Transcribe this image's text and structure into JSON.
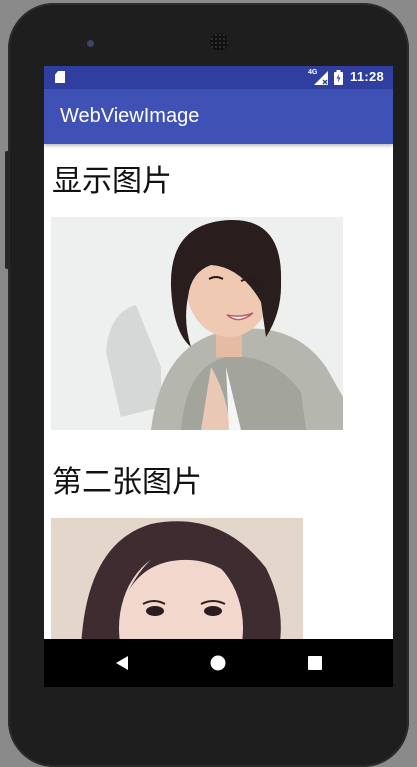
{
  "status_bar": {
    "time": "11:28",
    "network": "4G",
    "icons": [
      "sd-card-icon",
      "signal-icon",
      "battery-icon"
    ]
  },
  "app_bar": {
    "title": "WebViewImage"
  },
  "content": {
    "heading_1": "显示图片",
    "heading_2": "第二张图片",
    "images": [
      "photo-woman-short-hair",
      "photo-woman-long-hair"
    ]
  },
  "nav_bar": {
    "icons": [
      "back-icon",
      "home-icon",
      "recents-icon"
    ]
  },
  "colors": {
    "status_bar": "#303f9f",
    "app_bar": "#3f51b5",
    "page_background": "#ffffff",
    "nav_bar": "#000000"
  }
}
